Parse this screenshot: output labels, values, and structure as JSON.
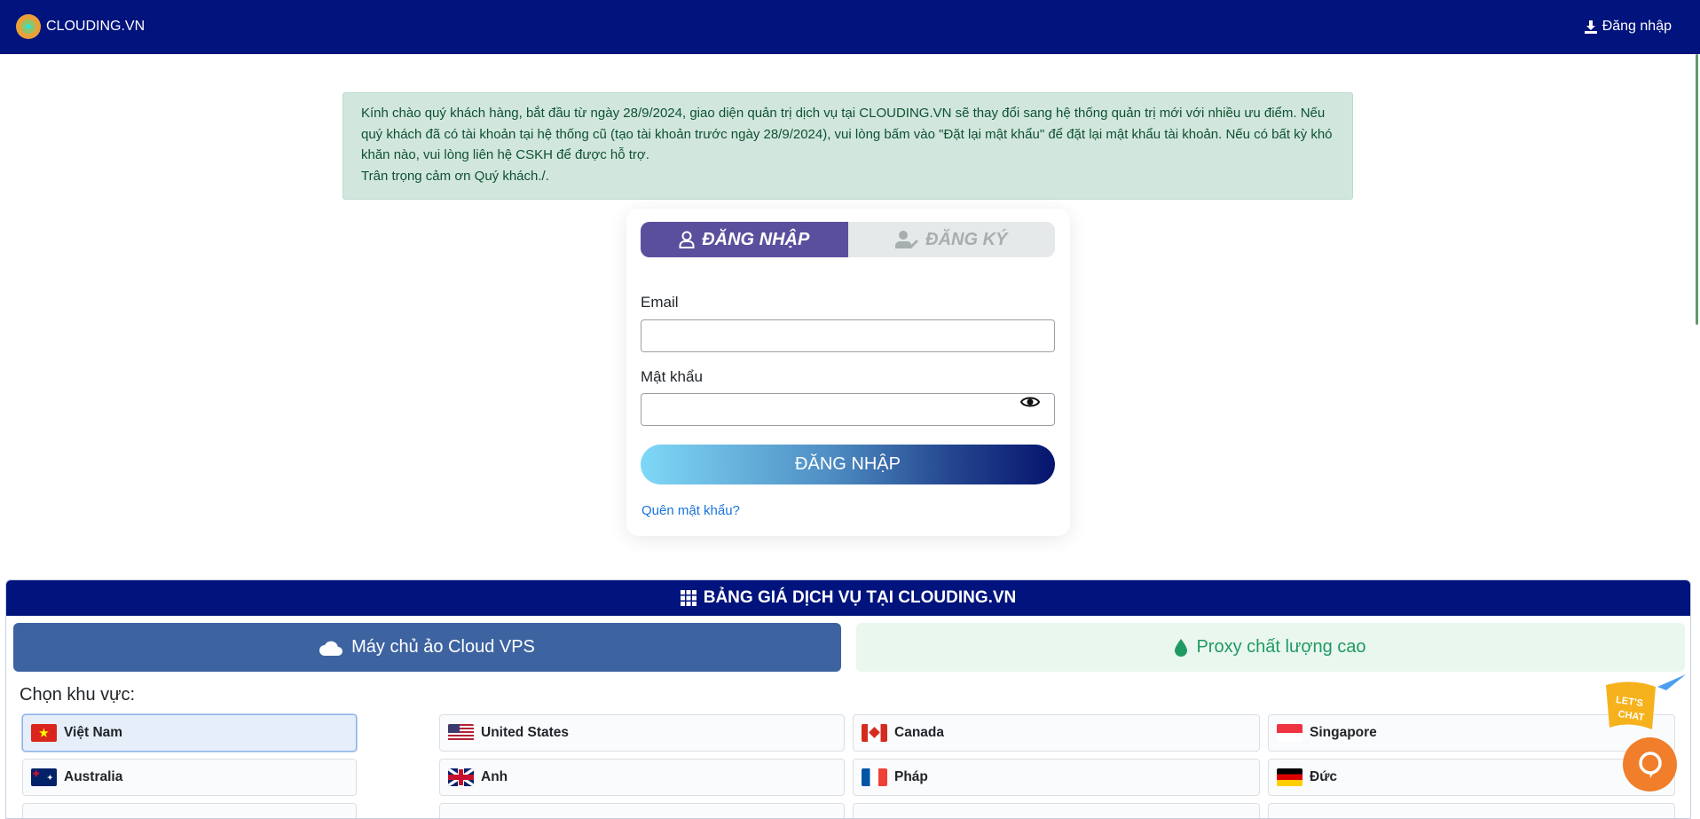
{
  "header": {
    "brand": "CLOUDING.VN",
    "login_link": "Đăng nhập"
  },
  "notice": {
    "text": "Kính chào quý khách hàng, bắt đầu từ ngày 28/9/2024, giao diện quản trị dịch vụ tại CLOUDING.VN sẽ thay đổi sang hệ thống quản trị mới với nhiều ưu điểm. Nếu quý khách đã có tài khoản tại hệ thống cũ (tạo tài khoản trước ngày 28/9/2024), vui lòng bấm vào \"Đặt lại mật khẩu\" để đặt lại mật khẩu tài khoản. Nếu có bất kỳ khó khăn nào, vui lòng liên hệ CSKH để được hỗ trợ.",
    "closing": "Trân trọng cảm ơn Quý khách./."
  },
  "auth": {
    "tab_login": "ĐĂNG NHẬP",
    "tab_register": "ĐĂNG KÝ",
    "email_label": "Email",
    "email_value": "",
    "password_label": "Mật khẩu",
    "password_value": "",
    "submit": "ĐĂNG NHẬP",
    "forgot": "Quên mật khẩu?"
  },
  "pricing": {
    "title": "BẢNG GIÁ DỊCH VỤ TẠI CLOUDING.VN",
    "tab_vps": "Máy chủ ảo Cloud VPS",
    "tab_proxy": "Proxy chất lượng cao",
    "region_label": "Chọn khu vực:",
    "countries": [
      {
        "name": "Việt Nam",
        "flag": "vn",
        "selected": true
      },
      {
        "name": "United States",
        "flag": "us"
      },
      {
        "name": "Canada",
        "flag": "ca"
      },
      {
        "name": "Singapore",
        "flag": "sg"
      },
      {
        "name": "Australia",
        "flag": "au"
      },
      {
        "name": "Anh",
        "flag": "gb"
      },
      {
        "name": "Pháp",
        "flag": "fr"
      },
      {
        "name": "Đức",
        "flag": "de"
      }
    ]
  },
  "chat": {
    "badge": "LET'S CHAT"
  },
  "colors": {
    "header": "#01137c",
    "tab_active": "#5a4f9d",
    "vps_tab": "#3d63a0",
    "proxy_text": "#1f9a63",
    "chat": "#f07e2a"
  }
}
